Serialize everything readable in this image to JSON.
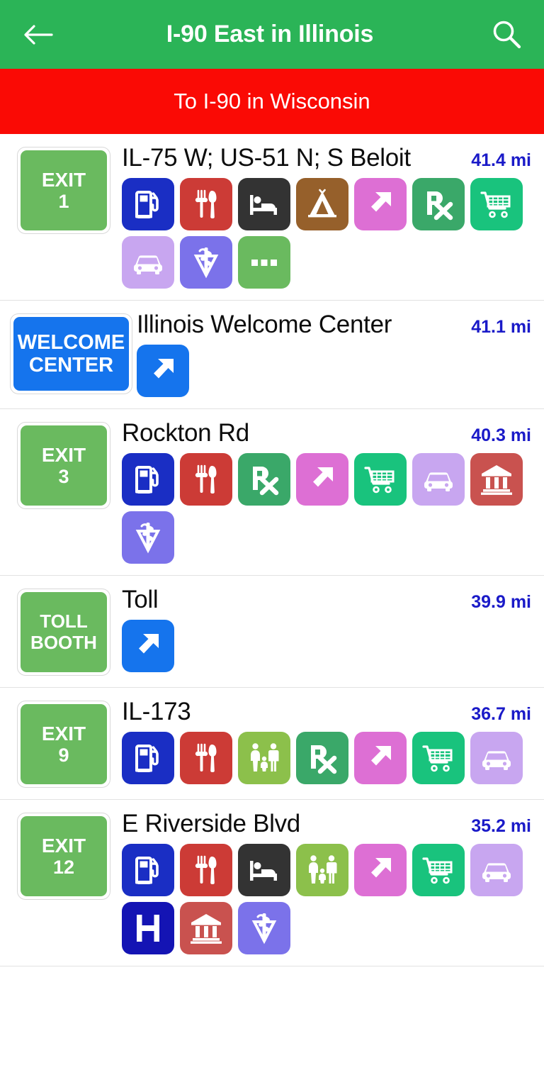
{
  "appbar": {
    "back_icon": "arrow-left-icon",
    "title": "I-90 East in Illinois",
    "search_icon": "search-icon",
    "background_color": "#2bb457"
  },
  "banner": {
    "text": "To I-90 in Wisconsin",
    "background_color": "#fa0a05",
    "text_color": "#ffffff"
  },
  "colors": {
    "exit_badge_green": "#6aba5f",
    "welcome_badge_blue": "#1574ed",
    "distance_blue": "#1a1ac8",
    "gas_blue": "#1a2ec4",
    "food_red": "#cc3b36",
    "lodging_dark": "#333333",
    "camping_brown": "#96602b",
    "arrow_pink": "#dd6fd4",
    "arrow_blue": "#1574ed",
    "pharmacy_green": "#3aa869",
    "shopping_teal": "#19c37d",
    "auto_lavender": "#c8a6f0",
    "vet_periwinkle": "#7b72ea",
    "more_green": "#6aba5f",
    "bank_red": "#c9524f",
    "attraction_green": "#8cc04b",
    "hospital_navy": "#1414b4"
  },
  "rows": [
    {
      "badge_type": "exit",
      "badge_line1": "EXIT",
      "badge_line2": "1",
      "title": "IL-75 W; US-51 N; S Beloit",
      "distance": "41.4 mi",
      "icons": [
        "gas-icon",
        "food-icon",
        "lodging-icon",
        "camping-icon",
        "arrow-pink-icon",
        "pharmacy-icon",
        "shopping-icon",
        "auto-icon",
        "vet-icon",
        "more-icon"
      ]
    },
    {
      "badge_type": "welcome",
      "badge_line1": "WELCOME",
      "badge_line2": "CENTER",
      "title": "Illinois Welcome Center",
      "distance": "41.1 mi",
      "icons": [
        "arrow-blue-icon"
      ]
    },
    {
      "badge_type": "exit",
      "badge_line1": "EXIT",
      "badge_line2": "3",
      "title": "Rockton Rd",
      "distance": "40.3 mi",
      "icons": [
        "gas-icon",
        "food-icon",
        "pharmacy-icon",
        "arrow-pink-icon",
        "shopping-icon",
        "auto-icon",
        "bank-icon",
        "vet-icon"
      ]
    },
    {
      "badge_type": "toll",
      "badge_line1": "TOLL",
      "badge_line2": "BOOTH",
      "title": "Toll",
      "distance": "39.9 mi",
      "icons": [
        "arrow-blue-icon"
      ]
    },
    {
      "badge_type": "exit",
      "badge_line1": "EXIT",
      "badge_line2": "9",
      "title": "IL-173",
      "distance": "36.7 mi",
      "icons": [
        "gas-icon",
        "food-icon",
        "attraction-icon",
        "pharmacy-icon",
        "arrow-pink-icon",
        "shopping-icon",
        "auto-icon"
      ]
    },
    {
      "badge_type": "exit",
      "badge_line1": "EXIT",
      "badge_line2": "12",
      "title": "E Riverside Blvd",
      "distance": "35.2 mi",
      "icons": [
        "gas-icon",
        "food-icon",
        "lodging-icon",
        "attraction-icon",
        "arrow-pink-icon",
        "shopping-icon",
        "auto-icon",
        "hospital-icon",
        "bank-icon",
        "vet-icon"
      ]
    }
  ]
}
